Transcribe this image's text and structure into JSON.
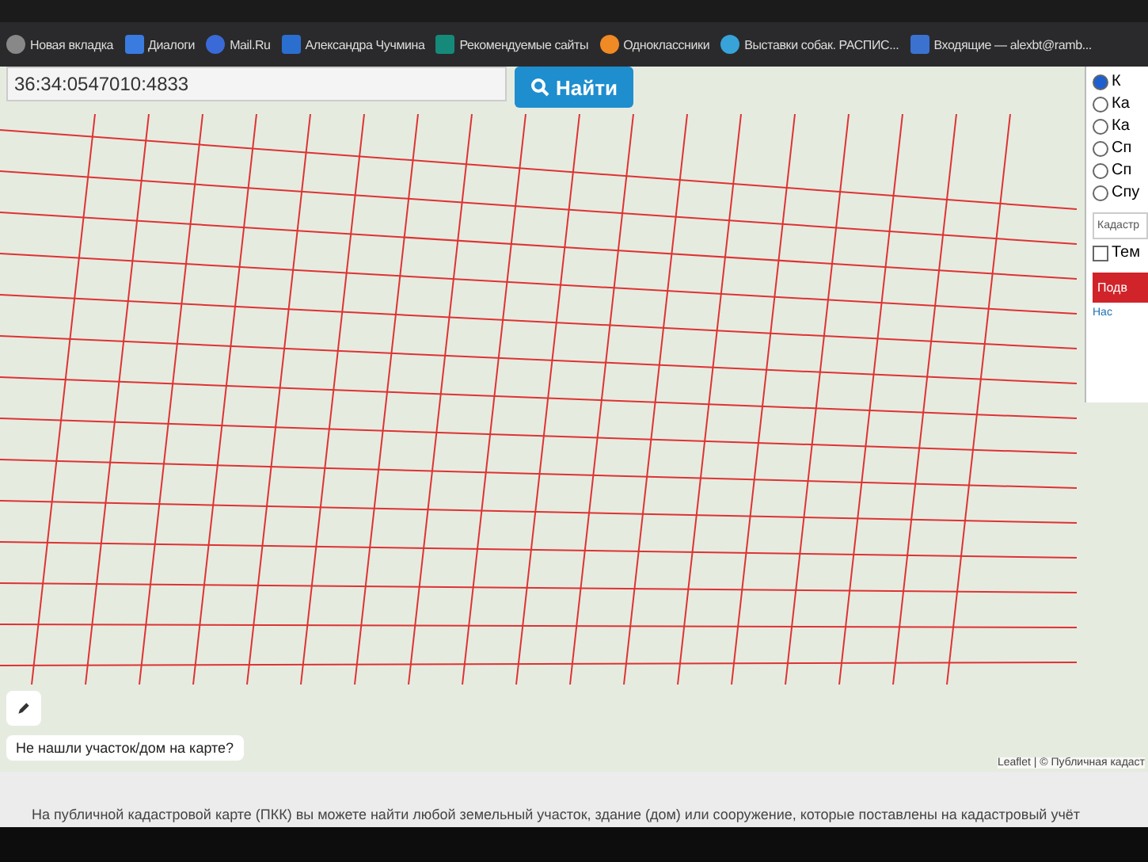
{
  "bookmarks": [
    {
      "label": "Новая вкладка",
      "kind": "globe"
    },
    {
      "label": "Диалоги",
      "kind": "chat"
    },
    {
      "label": "Mail.Ru",
      "kind": "at"
    },
    {
      "label": "Александра Чучмина",
      "kind": "square"
    },
    {
      "label": "Рекомендуемые сайты",
      "kind": "b"
    },
    {
      "label": "Одноклассники",
      "kind": "circle"
    },
    {
      "label": "Выставки собак. РАСПИС...",
      "kind": "bubble"
    },
    {
      "label": "Входящие — alexbt@ramb...",
      "kind": "mail"
    }
  ],
  "search": {
    "value": "36:34:0547010:4833",
    "button": "Найти"
  },
  "panel": {
    "options": [
      {
        "label": "К",
        "selected": true
      },
      {
        "label": "Ка",
        "selected": false
      },
      {
        "label": "Ка",
        "selected": false
      },
      {
        "label": "Сп",
        "selected": false
      },
      {
        "label": "Сп",
        "selected": false
      },
      {
        "label": "Спу",
        "selected": false
      }
    ],
    "field_label": "Кадастр",
    "checkbox": {
      "label": "Тем",
      "checked": false
    },
    "button": "Подв",
    "link": "Нас"
  },
  "map": {
    "help_button": "Не нашли участок/дом на карте?",
    "attribution": "Leaflet | © Публичная кадаст"
  },
  "footer_text": "На публичной кадастровой карте (ПКК) вы можете найти любой земельный участок, здание (дом) или сооружение, которые поставлены на кадастровый учёт"
}
